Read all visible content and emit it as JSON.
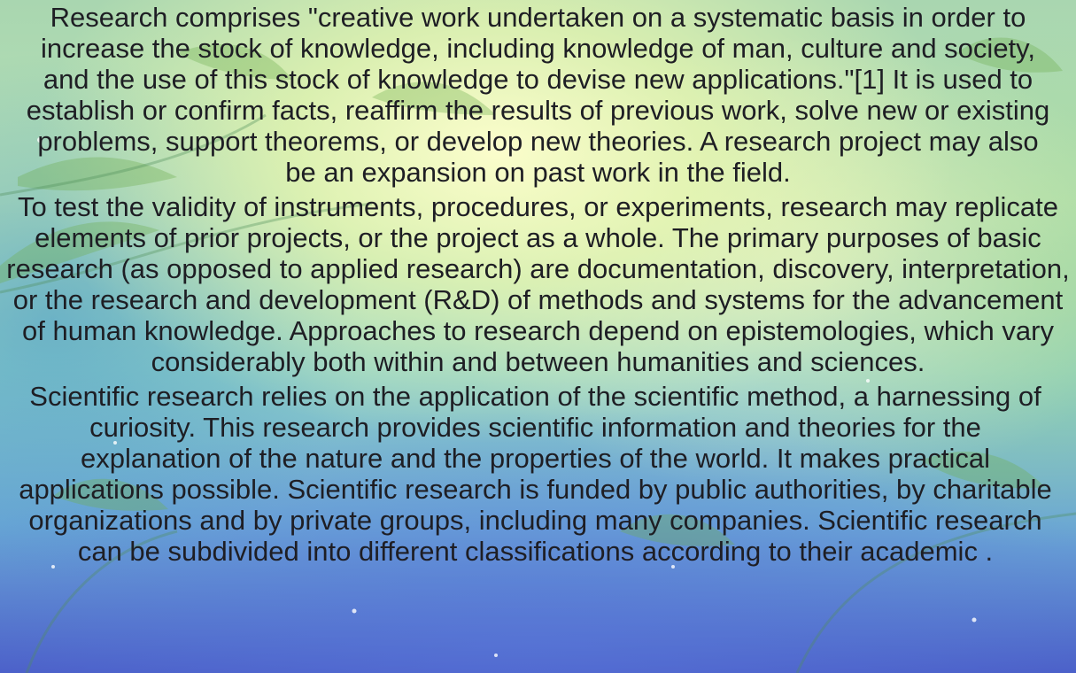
{
  "document": {
    "paragraphs": [
      "Research comprises \"creative work undertaken on a systematic basis in order to increase the stock of knowledge, including knowledge of man, culture and society, and the use of this stock of knowledge to devise new applications.\"[1] It is used to establish or confirm facts, reaffirm the results of previous work, solve new or existing problems, support theorems, or develop new theories. A research project may also be an expansion on past work in the field.",
      "To test the validity of instruments, procedures, or experiments, research may replicate elements of prior projects, or the project as a whole. The primary purposes of basic research (as opposed to applied research) are documentation, discovery, interpretation, or the research and development (R&D) of methods and systems for the advancement of human knowledge. Approaches to research depend on epistemologies, which vary considerably both within and between humanities and sciences.",
      "Scientific research relies on the application of the scientific method, a harnessing of curiosity. This research provides scientific information and theories for the explanation of the nature and the properties of the world. It makes practical applications possible. Scientific research is funded by public authorities, by charitable organizations and by private groups, including many companies. Scientific research can be subdivided into different classifications according to their academic ."
    ]
  },
  "colors": {
    "text": "#1e1e24",
    "glow": "#fffccd",
    "leaf": "#6fae4f",
    "deep_blue": "#4b5fc8"
  }
}
